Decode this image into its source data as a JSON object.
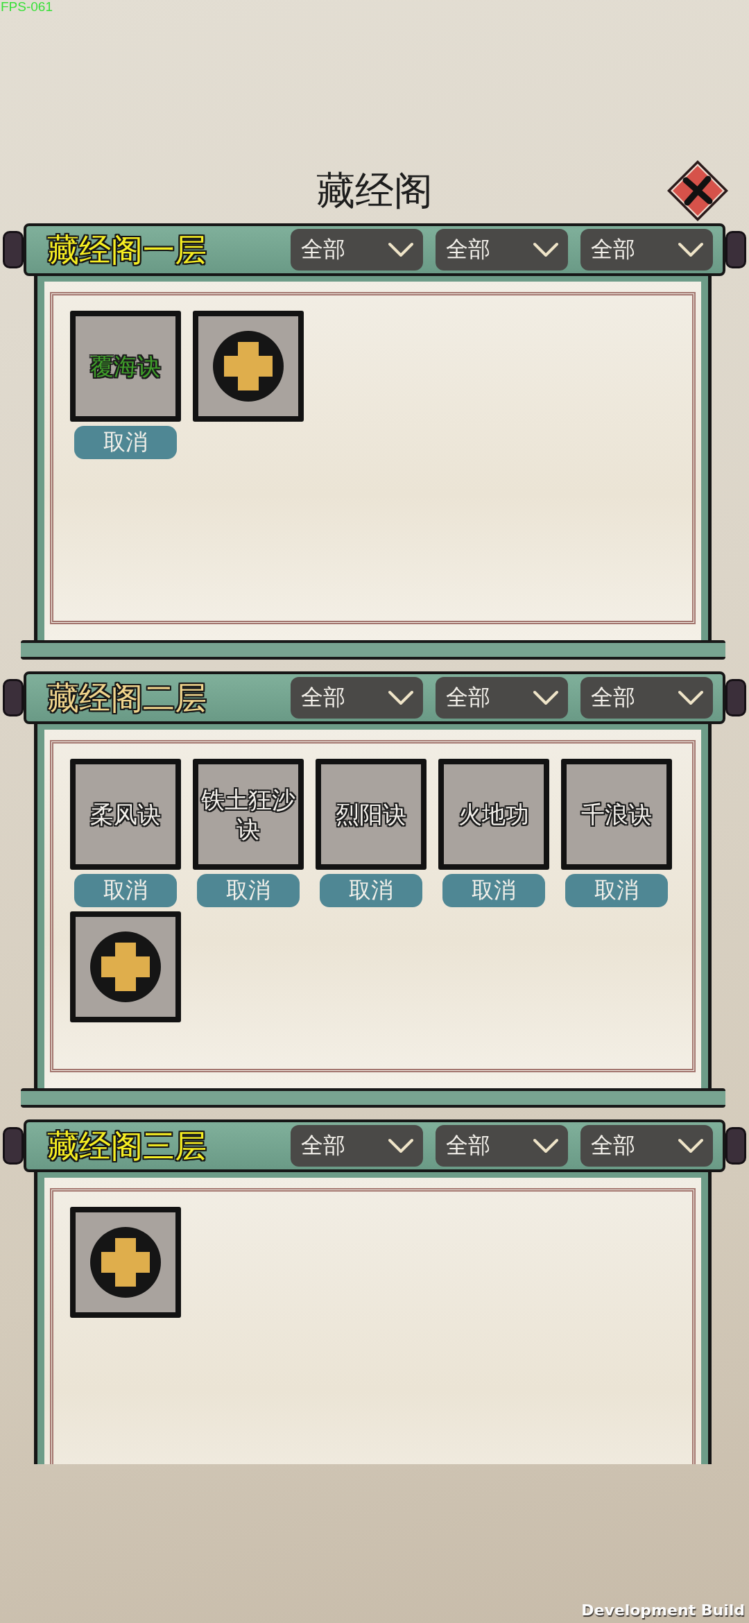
{
  "status": {
    "fps": "FPS-061"
  },
  "title": "藏经阁",
  "sections": [
    {
      "title": "藏经阁一层",
      "color": "#f6ee22",
      "filters": [
        "全部",
        "全部",
        "全部"
      ],
      "items": [
        {
          "kind": "skill",
          "name": "覆海诀",
          "color": "#3f9e2a",
          "action": "取消"
        },
        {
          "kind": "add"
        }
      ]
    },
    {
      "title": "藏经阁二层",
      "color": "#f0d48c",
      "filters": [
        "全部",
        "全部",
        "全部"
      ],
      "items": [
        {
          "kind": "skill",
          "name": "柔风诀",
          "color": "#f4f1ec",
          "action": "取消"
        },
        {
          "kind": "skill",
          "name": "铁土狂沙诀",
          "color": "#f4f1ec",
          "action": "取消"
        },
        {
          "kind": "skill",
          "name": "烈阳诀",
          "color": "#f4f1ec",
          "action": "取消"
        },
        {
          "kind": "skill",
          "name": "火地功",
          "color": "#f4f1ec",
          "action": "取消"
        },
        {
          "kind": "skill",
          "name": "千浪诀",
          "color": "#f4f1ec",
          "action": "取消"
        },
        {
          "kind": "add"
        }
      ]
    },
    {
      "title": "藏经阁三层",
      "color": "#f6ee22",
      "filters": [
        "全部",
        "全部",
        "全部"
      ],
      "items": [
        {
          "kind": "add"
        }
      ]
    }
  ],
  "build_label": "Development Build"
}
